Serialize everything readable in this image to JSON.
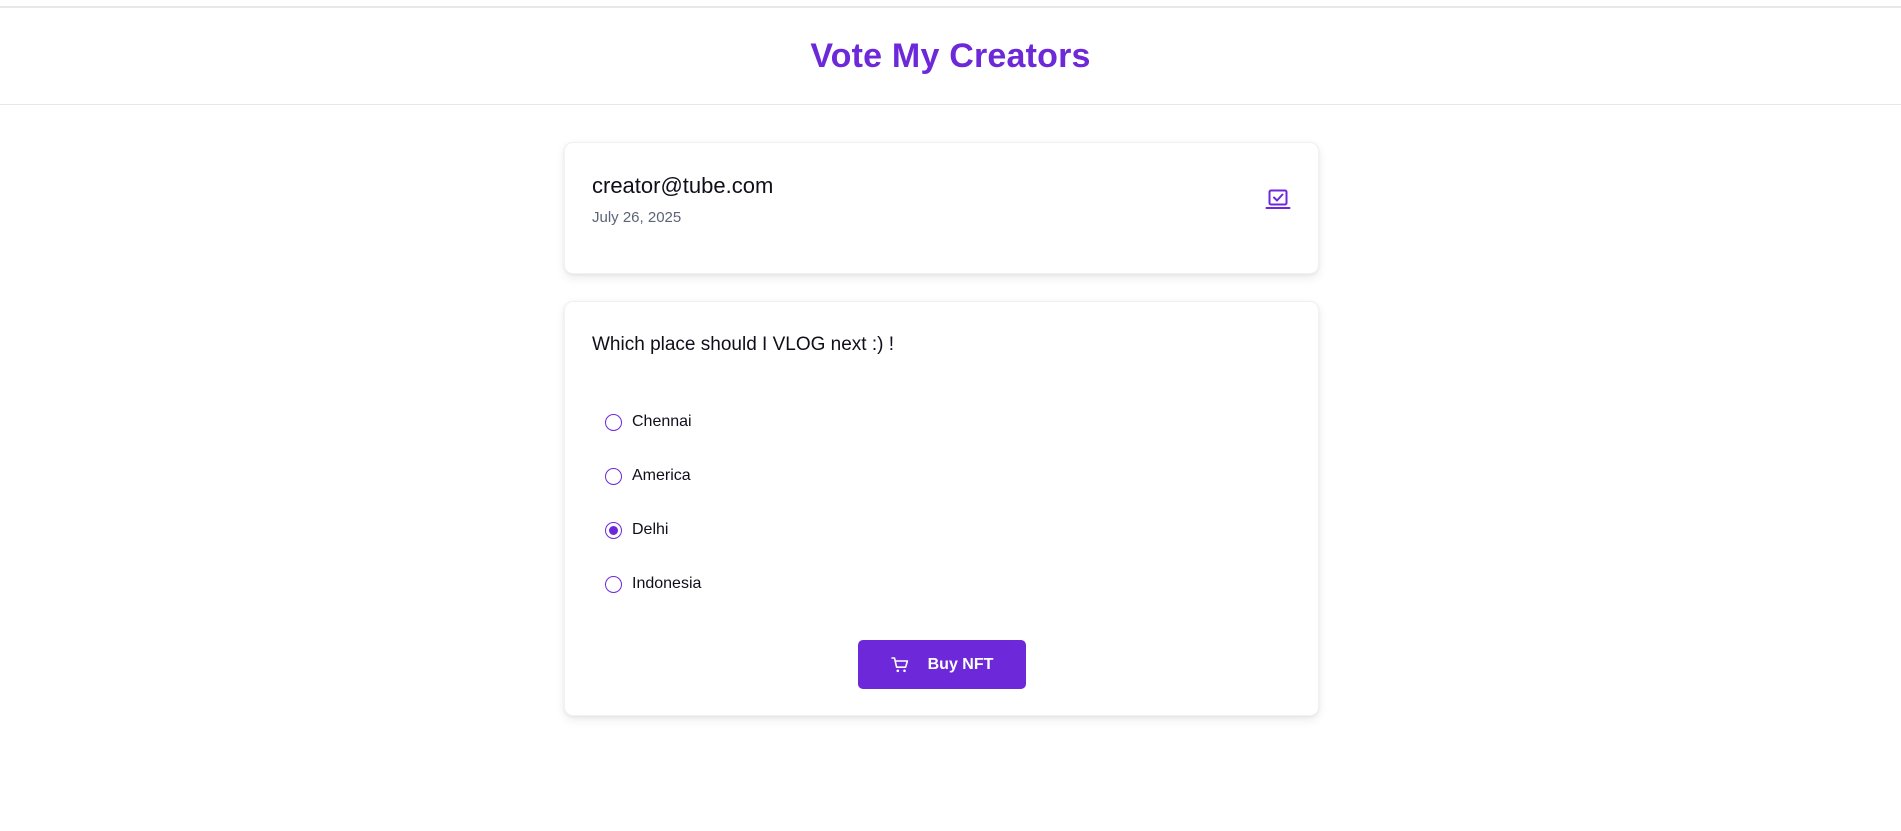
{
  "app": {
    "title": "Vote My Creators"
  },
  "profile": {
    "email": "creator@tube.com",
    "date": "July 26, 2025",
    "action_icon": "checkbox-laptop-icon"
  },
  "poll": {
    "question": "Which place should I VLOG next :) !",
    "options": [
      {
        "label": "Chennai",
        "selected": false
      },
      {
        "label": "America",
        "selected": false
      },
      {
        "label": "Delhi",
        "selected": true
      },
      {
        "label": "Indonesia",
        "selected": false
      }
    ],
    "selected_option": "Delhi",
    "buy_button": {
      "label": "Buy NFT",
      "icon": "cart-icon"
    }
  },
  "colors": {
    "accent": "#6d28d9",
    "muted_text": "#5b6478",
    "text": "#0f0f1a"
  }
}
